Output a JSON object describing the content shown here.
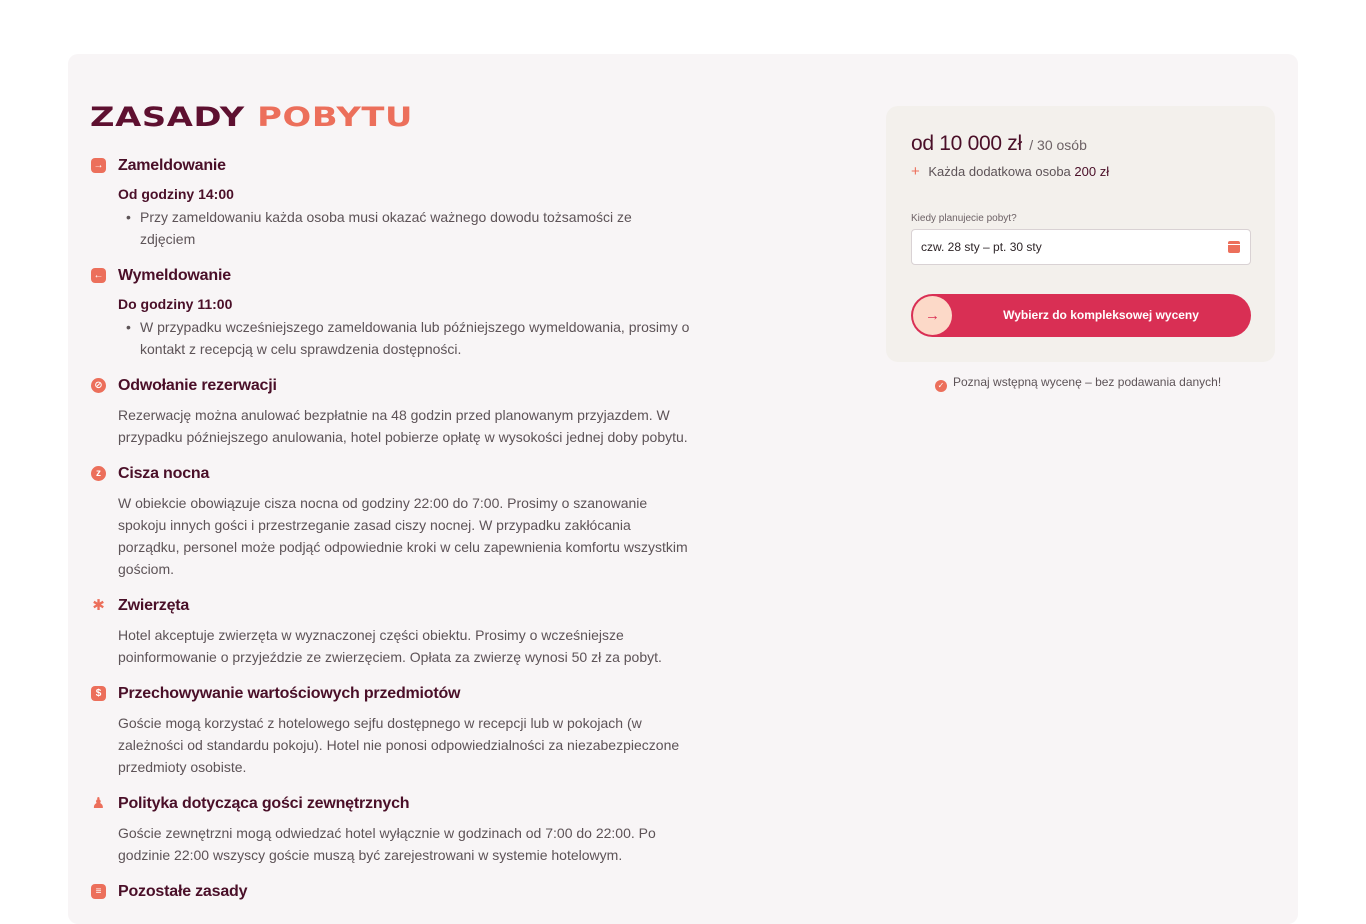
{
  "title": {
    "part1": "ZASADY",
    "part2": "POBYTU"
  },
  "rules": [
    {
      "icon": "checkin-icon",
      "title": "Zameldowanie",
      "subtitle": "Od godziny 14:00",
      "bullets": [
        "Przy zameldowaniu każda osoba musi okazać ważnego dowodu tożsamości ze zdjęciem"
      ]
    },
    {
      "icon": "checkout-icon",
      "title": "Wymeldowanie",
      "subtitle": "Do godziny 11:00",
      "bullets": [
        "W przypadku wcześniejszego zameldowania lub późniejszego wymeldowania, prosimy o kontakt z recepcją w celu sprawdzenia dostępności."
      ]
    },
    {
      "icon": "cancel-icon",
      "title": "Odwołanie rezerwacji",
      "text": "Rezerwację można anulować bezpłatnie na 48 godzin przed planowanym przyjazdem. W przypadku późniejszego anulowania, hotel pobierze opłatę w wysokości jednej doby pobytu."
    },
    {
      "icon": "alarm-clock-icon",
      "title": "Cisza nocna",
      "text": "W obiekcie obowiązuje cisza nocna od godziny 22:00 do 7:00. Prosimy o szanowanie spokoju innych gości i przestrzeganie zasad ciszy nocnej. W przypadku zakłócania porządku, personel może podjąć odpowiednie kroki w celu zapewnienia komfortu wszystkim gościom."
    },
    {
      "icon": "paw-icon",
      "title": "Zwierzęta",
      "text": "Hotel akceptuje zwierzęta w wyznaczonej części obiektu. Prosimy o wcześniejsze poinformowanie o przyjeździe ze zwierzęciem. Opłata za zwierzę wynosi 50 zł za pobyt."
    },
    {
      "icon": "money-bag-icon",
      "title": "Przechowywanie wartościowych przedmiotów",
      "text": "Goście mogą korzystać z hotelowego sejfu dostępnego w recepcji lub w pokojach (w zależności od standardu pokoju). Hotel nie ponosi odpowiedzialności za niezabezpieczone przedmioty osobiste."
    },
    {
      "icon": "guest-icon",
      "title": "Polityka dotycząca gości zewnętrznych",
      "text": "Goście zewnętrzni mogą odwiedzać hotel wyłącznie w godzinach od 7:00 do 22:00. Po godzinie 22:00 wszyscy goście muszą być zarejestrowani w systemie hotelowym."
    },
    {
      "icon": "document-icon",
      "title": "Pozostałe zasady"
    }
  ],
  "booking": {
    "price": "od 10 000 zł",
    "per": "/ 30 osób",
    "extra_plus": "+",
    "extra_label": "Każda dodatkowa osoba",
    "extra_amount": "200 zł",
    "date_label": "Kiedy planujecie pobyt?",
    "date_value": "czw. 28 sty – pt. 30 sty",
    "cta_label": "Wybierz do kompleksowej wyceny",
    "note": "Poznaj wstępną wycenę – bez podawania danych!"
  },
  "colors": {
    "brand_dark": "#5e1030",
    "accent": "#ec6f5b",
    "cta": "#d92f54"
  }
}
